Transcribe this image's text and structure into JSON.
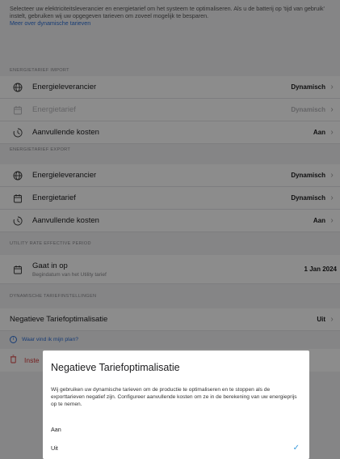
{
  "intro": {
    "text": "Selecteer uw elektriciteitsleverancier en energietarief om het systeem te optimaliseren. Als u de batterij op 'tijd van gebruik' instelt, gebruiken wij uw opgegeven tarieven om zoveel mogelijk te besparen.",
    "link": "Meer over dynamische tarieven"
  },
  "import": {
    "header": "ENERGIETARIEF IMPORT",
    "rows": [
      {
        "label": "Energieleverancier",
        "value": "Dynamisch",
        "icon": "globe-icon"
      },
      {
        "label": "Energietarief",
        "value": "Dynamisch",
        "icon": "calendar-icon"
      },
      {
        "label": "Aanvullende kosten",
        "value": "Aan",
        "icon": "cost-dial-icon"
      }
    ]
  },
  "export": {
    "header": "ENERGIETARIEF EXPORT",
    "rows": [
      {
        "label": "Energieleverancier",
        "value": "Dynamisch",
        "icon": "globe-icon"
      },
      {
        "label": "Energietarief",
        "value": "Dynamisch",
        "icon": "calendar-icon"
      },
      {
        "label": "Aanvullende kosten",
        "value": "Aan",
        "icon": "cost-dial-icon"
      }
    ]
  },
  "utility": {
    "header": "UTILITY RATE EFFECTIVE PERIOD",
    "label": "Gaat in op",
    "sublabel": "Begindatum van het Utility tarief",
    "value": "1 Jan 2024"
  },
  "dynamic": {
    "header": "DYNAMISCHE TARIEFINSTELLINGEN",
    "label": "Negatieve Tariefoptimalisatie",
    "value": "Uit"
  },
  "help_link": "Waar vind ik mijn plan?",
  "danger_label": "Inste",
  "modal": {
    "title": "Negatieve Tariefoptimalisatie",
    "text": "Wij gebruiken uw dynamische tarieven om de productie te optimaliseren en te stoppen als de exporttarieven negatief zijn. Configureer aanvullende kosten om ze in de berekening van uw energieprijs op te nemen.",
    "options": [
      {
        "label": "Aan",
        "selected": false
      },
      {
        "label": "Uit",
        "selected": true
      }
    ]
  },
  "colors": {
    "accent": "#2d6fd6",
    "danger": "#d63b3b",
    "check": "#3a9bdc"
  }
}
